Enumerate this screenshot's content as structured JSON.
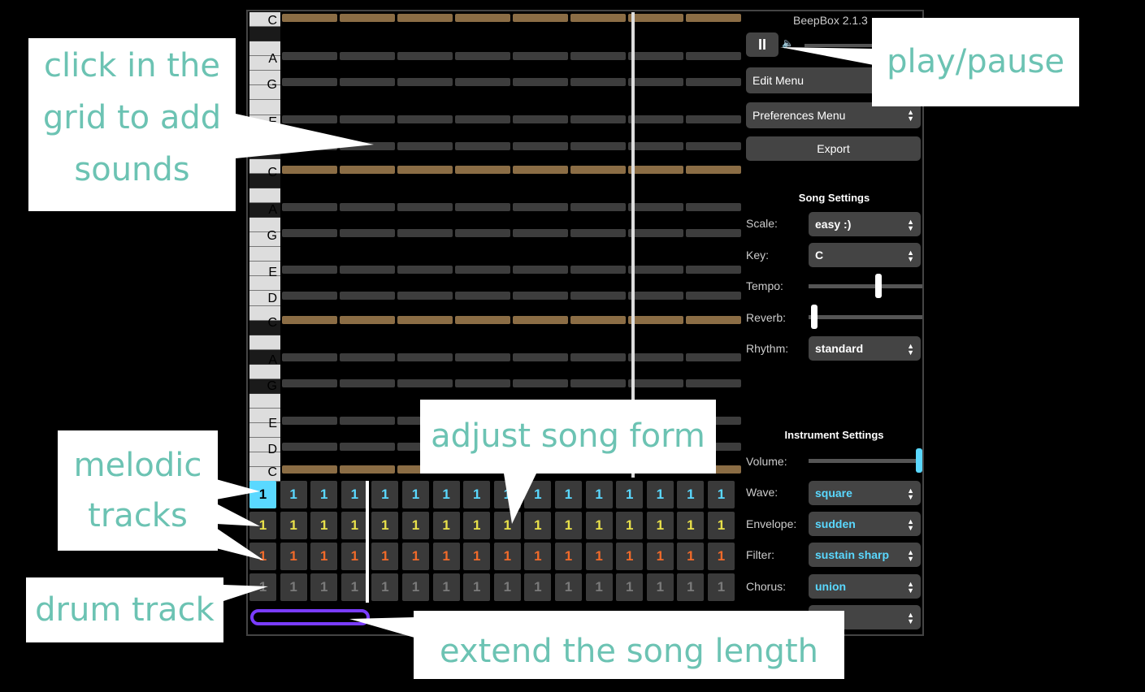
{
  "app": {
    "title": "BeepBox 2.1.3",
    "play_pause_glyph": "II",
    "volume_icon": "speaker-icon",
    "edit_menu": "Edit Menu",
    "preferences_menu": "Preferences Menu",
    "export": "Export"
  },
  "piano": {
    "key_labels": [
      "C",
      "A",
      "G",
      "E",
      "D",
      "C",
      "A",
      "G",
      "E",
      "D",
      "C",
      "A",
      "G",
      "E",
      "D",
      "C"
    ]
  },
  "song_settings": {
    "heading": "Song Settings",
    "scale_label": "Scale:",
    "scale_value": "easy :)",
    "key_label": "Key:",
    "key_value": "C",
    "tempo_label": "Tempo:",
    "tempo_level": 0.62,
    "reverb_label": "Reverb:",
    "reverb_level": 0.02,
    "rhythm_label": "Rhythm:",
    "rhythm_value": "standard"
  },
  "instrument_settings": {
    "heading": "Instrument Settings",
    "volume_label": "Volume:",
    "volume_level": 1.0,
    "wave_label": "Wave:",
    "wave_value": "square",
    "envelope_label": "Envelope:",
    "envelope_value": "sudden",
    "filter_label": "Filter:",
    "filter_value": "sustain sharp",
    "chorus_label": "Chorus:",
    "chorus_value": "union"
  },
  "tracks": {
    "pattern_number": "1",
    "colors": [
      "#5ad8ff",
      "#e8e04a",
      "#f06a2a",
      "#7a7a7a"
    ]
  },
  "callouts": {
    "grid": "click in the grid to add sounds",
    "play": "play/pause",
    "song_form": "adjust song form",
    "melodic": "melodic tracks",
    "drum": "drum track",
    "length": "extend the song length"
  }
}
